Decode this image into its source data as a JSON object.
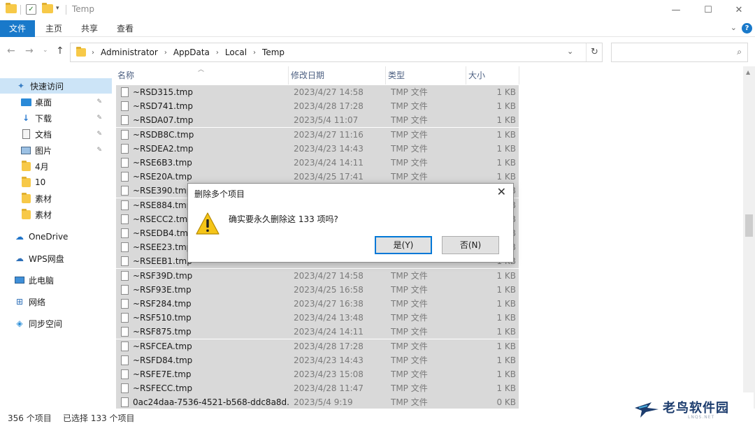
{
  "window": {
    "title": "Temp",
    "minimize": "—",
    "maximize": "☐",
    "close": "✕"
  },
  "ribbon": {
    "tabs": [
      "文件",
      "主页",
      "共享",
      "查看"
    ],
    "help": "?",
    "collapse": "⌄"
  },
  "address": {
    "crumbs": [
      "Administrator",
      "AppData",
      "Local",
      "Temp"
    ],
    "search_placeholder": ""
  },
  "sidebar": {
    "items": [
      {
        "label": "快速访问",
        "icon": "star-icon"
      },
      {
        "label": "桌面",
        "icon": "desktop-icon",
        "pinned": true
      },
      {
        "label": "下载",
        "icon": "download-icon",
        "pinned": true
      },
      {
        "label": "文档",
        "icon": "document-icon",
        "pinned": true
      },
      {
        "label": "图片",
        "icon": "picture-icon",
        "pinned": true
      },
      {
        "label": "4月",
        "icon": "folder-icon"
      },
      {
        "label": "10",
        "icon": "folder-icon"
      },
      {
        "label": "素材",
        "icon": "folder-icon"
      },
      {
        "label": "素材",
        "icon": "folder-icon"
      },
      {
        "label": "OneDrive",
        "icon": "cloud-icon"
      },
      {
        "label": "WPS网盘",
        "icon": "cloud-icon"
      },
      {
        "label": "此电脑",
        "icon": "computer-icon"
      },
      {
        "label": "网络",
        "icon": "network-icon"
      },
      {
        "label": "同步空间",
        "icon": "sync-icon"
      }
    ]
  },
  "columns": [
    "名称",
    "修改日期",
    "类型",
    "大小"
  ],
  "files": [
    {
      "name": "~RSD315.tmp",
      "date": "2023/4/27 14:58",
      "type": "TMP 文件",
      "size": "1 KB"
    },
    {
      "name": "~RSD741.tmp",
      "date": "2023/4/28 17:28",
      "type": "TMP 文件",
      "size": "1 KB"
    },
    {
      "name": "~RSDA07.tmp",
      "date": "2023/5/4 11:07",
      "type": "TMP 文件",
      "size": "1 KB"
    },
    {
      "name": "~RSDB8C.tmp",
      "date": "2023/4/27 11:16",
      "type": "TMP 文件",
      "size": "1 KB"
    },
    {
      "name": "~RSDEA2.tmp",
      "date": "2023/4/23 14:43",
      "type": "TMP 文件",
      "size": "1 KB"
    },
    {
      "name": "~RSE6B3.tmp",
      "date": "2023/4/24 14:11",
      "type": "TMP 文件",
      "size": "1 KB"
    },
    {
      "name": "~RSE20A.tmp",
      "date": "2023/4/25 17:41",
      "type": "TMP 文件",
      "size": "1 KB"
    },
    {
      "name": "~RSE390.tmp",
      "date": "",
      "type": "",
      "size": "1 KB"
    },
    {
      "name": "~RSE884.tmp",
      "date": "",
      "type": "",
      "size": "1 KB"
    },
    {
      "name": "~RSECC2.tmp",
      "date": "",
      "type": "",
      "size": "1 KB"
    },
    {
      "name": "~RSEDB4.tmp",
      "date": "",
      "type": "",
      "size": "1 KB"
    },
    {
      "name": "~RSEE23.tmp",
      "date": "",
      "type": "",
      "size": "1 KB"
    },
    {
      "name": "~RSEEB1.tmp",
      "date": "",
      "type": "",
      "size": "1 KB"
    },
    {
      "name": "~RSF39D.tmp",
      "date": "2023/4/27 14:58",
      "type": "TMP 文件",
      "size": "1 KB"
    },
    {
      "name": "~RSF93E.tmp",
      "date": "2023/4/25 16:58",
      "type": "TMP 文件",
      "size": "1 KB"
    },
    {
      "name": "~RSF284.tmp",
      "date": "2023/4/27 16:38",
      "type": "TMP 文件",
      "size": "1 KB"
    },
    {
      "name": "~RSF510.tmp",
      "date": "2023/4/24 13:48",
      "type": "TMP 文件",
      "size": "1 KB"
    },
    {
      "name": "~RSF875.tmp",
      "date": "2023/4/24 14:11",
      "type": "TMP 文件",
      "size": "1 KB"
    },
    {
      "name": "~RSFCEA.tmp",
      "date": "2023/4/28 17:28",
      "type": "TMP 文件",
      "size": "1 KB"
    },
    {
      "name": "~RSFD84.tmp",
      "date": "2023/4/23 14:43",
      "type": "TMP 文件",
      "size": "1 KB"
    },
    {
      "name": "~RSFE7E.tmp",
      "date": "2023/4/23 15:08",
      "type": "TMP 文件",
      "size": "1 KB"
    },
    {
      "name": "~RSFECC.tmp",
      "date": "2023/4/28 11:47",
      "type": "TMP 文件",
      "size": "1 KB"
    },
    {
      "name": "0ac24daa-7536-4521-b568-ddc8a8d...",
      "date": "2023/5/4 9:19",
      "type": "TMP 文件",
      "size": "0 KB"
    }
  ],
  "status": {
    "count": "356 个项目",
    "selected": "已选择 133 个项目"
  },
  "dialog": {
    "title": "删除多个项目",
    "message": "确实要永久删除这 133 项吗?",
    "yes": "是(Y)",
    "no": "否(N)",
    "close": "✕"
  },
  "watermark": {
    "text": "老鸟软件园",
    "sub": "LNQS.NET"
  },
  "colors": {
    "accent": "#1979ca",
    "selection": "#d9d9d9",
    "sidebar_active": "#cce4f7",
    "header_text": "#4d6082"
  }
}
